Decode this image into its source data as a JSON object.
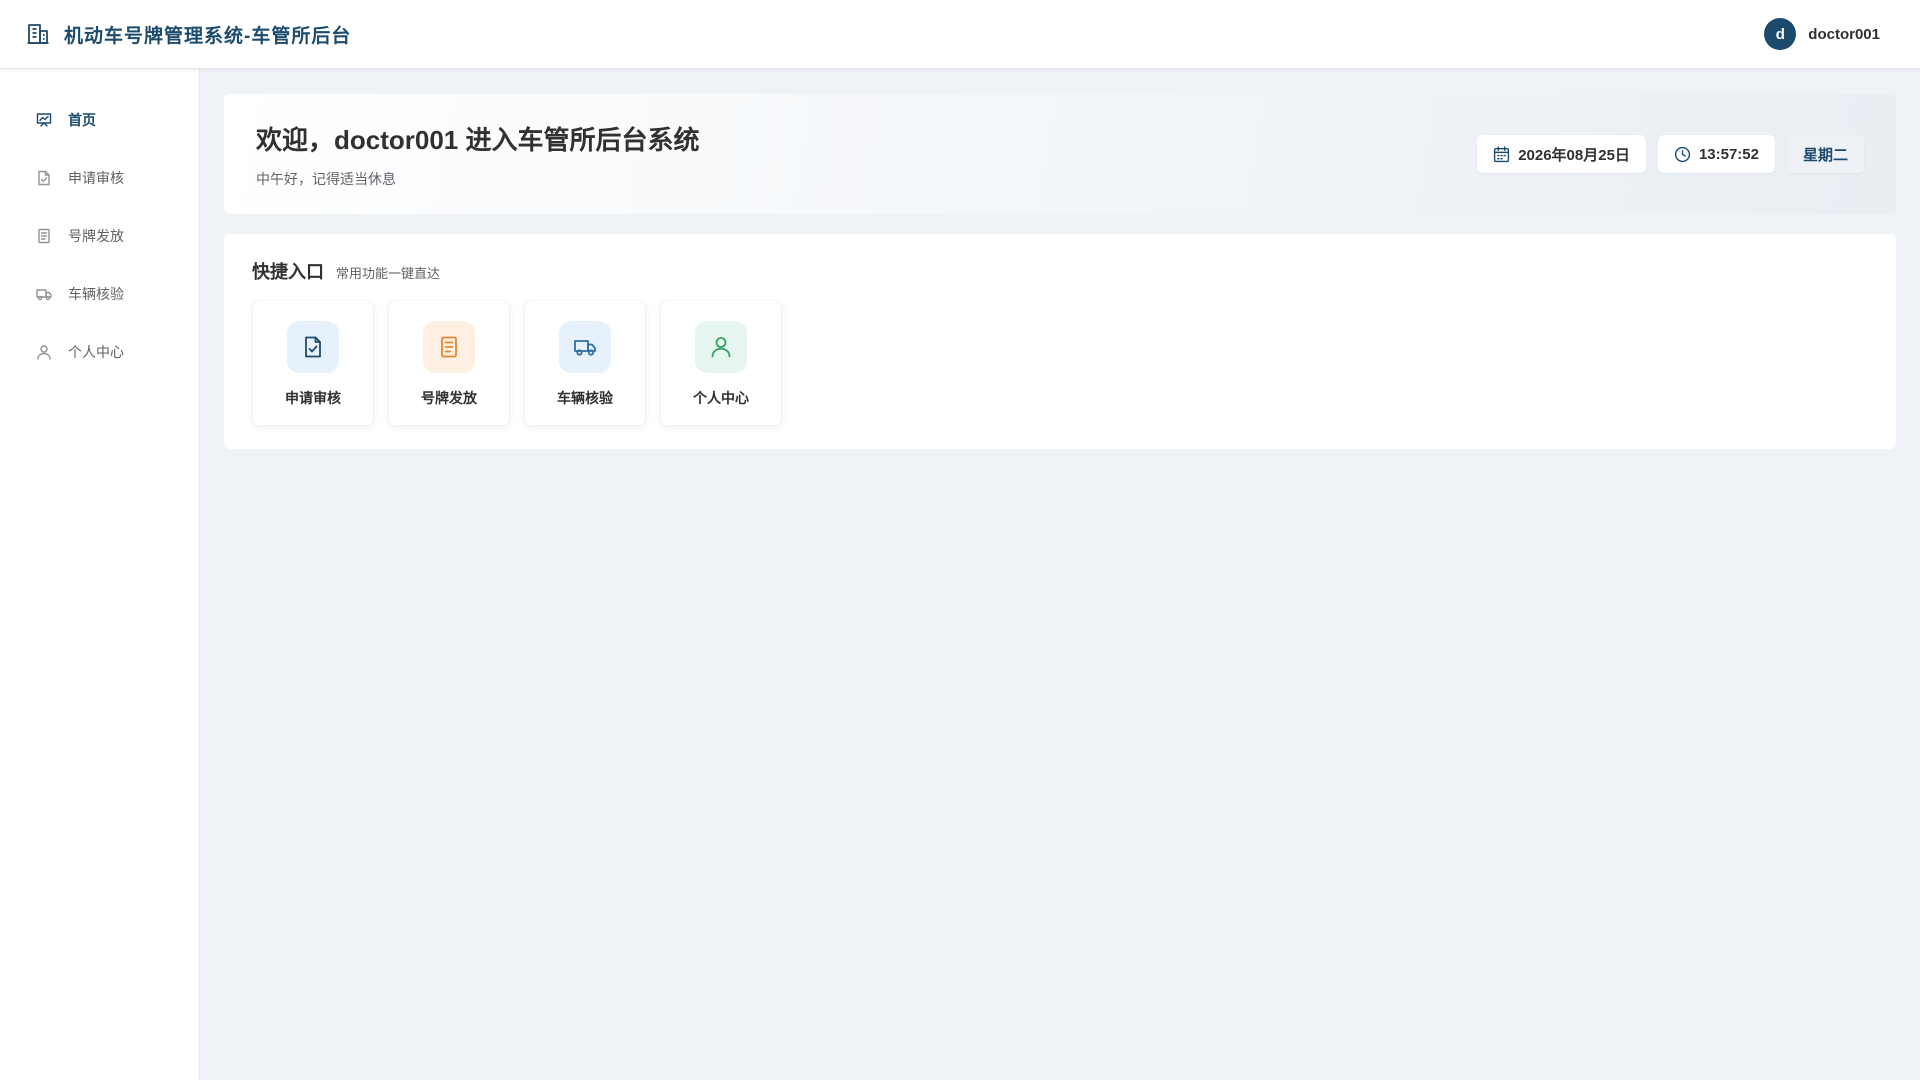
{
  "header": {
    "title": "机动车号牌管理系统-车管所后台",
    "logo_icon": "building-icon",
    "avatar_letter": "d",
    "username": "doctor001"
  },
  "sidebar": {
    "items": [
      {
        "label": "首页",
        "icon": "dashboard-icon",
        "active": true
      },
      {
        "label": "申请审核",
        "icon": "file-check-icon"
      },
      {
        "label": "号牌发放",
        "icon": "document-list-icon"
      },
      {
        "label": "车辆核验",
        "icon": "truck-icon"
      },
      {
        "label": "个人中心",
        "icon": "user-icon"
      }
    ]
  },
  "welcome": {
    "title": "欢迎，doctor001 进入车管所后台系统",
    "subtitle": "中午好，记得适当休息",
    "date": "2026年08月25日",
    "time": "13:57:52",
    "weekday": "星期二"
  },
  "quick_access": {
    "title": "快捷入口",
    "subtitle": "常用功能一键直达",
    "items": [
      {
        "label": "申请审核",
        "icon": "file-check-icon",
        "color": "#1d4b6e",
        "bg": "#e7f1fb"
      },
      {
        "label": "号牌发放",
        "icon": "document-list-icon",
        "color": "#e6862e",
        "bg": "#fdf0e2"
      },
      {
        "label": "车辆核验",
        "icon": "truck-icon",
        "color": "#2f6ea3",
        "bg": "#e7f1fb"
      },
      {
        "label": "个人中心",
        "icon": "user-icon",
        "color": "#35a46a",
        "bg": "#e6f6ee"
      }
    ]
  },
  "colors": {
    "primary": "#1d4b6e",
    "background": "#eff3f7"
  }
}
